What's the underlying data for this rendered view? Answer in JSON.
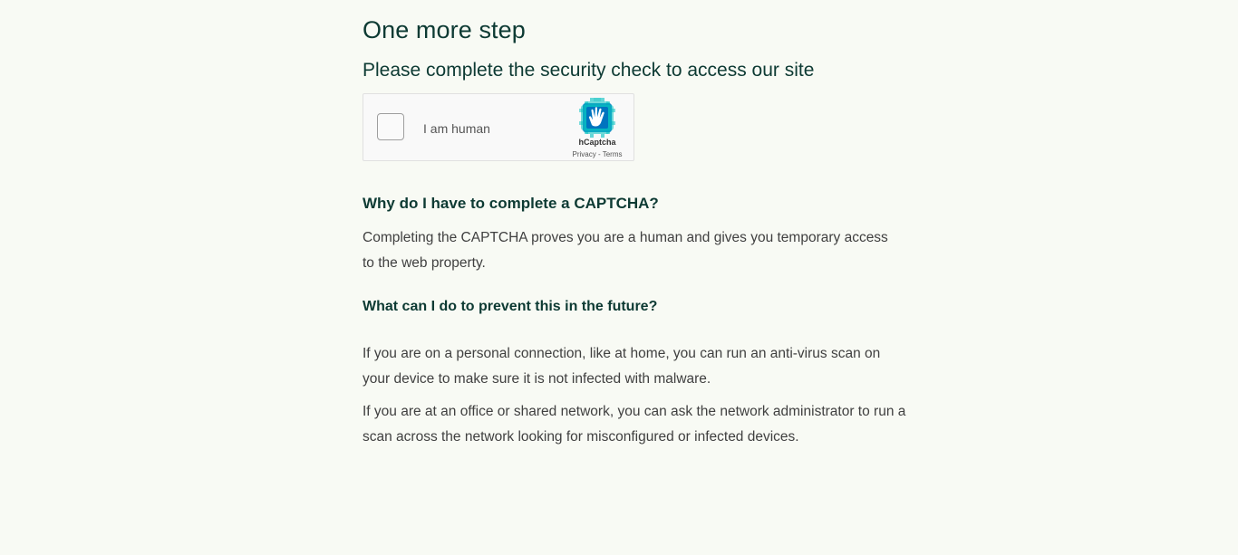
{
  "page": {
    "title": "One more step",
    "subtitle": "Please complete the security check to access our site"
  },
  "captcha": {
    "label": "I am human",
    "brand": "hCaptcha",
    "privacy_link": "Privacy",
    "separator": " - ",
    "terms_link": "Terms",
    "checked": false,
    "logo_icon": "hcaptcha-hand-icon",
    "colors": {
      "logo_dark": "#0074bf",
      "logo_mid": "#0082bf",
      "logo_light": "#00bfbf"
    }
  },
  "faq": {
    "q1": "Why do I have to complete a CAPTCHA?",
    "a1": "Completing the CAPTCHA proves you are a human and gives you temporary access to the web property.",
    "q2": "What can I do to prevent this in the future?",
    "a2": "If you are on a personal connection, like at home, you can run an anti-virus scan on your device to make sure it is not infected with malware.",
    "a3": "If you are at an office or shared network, you can ask the network administrator to run a scan across the network looking for misconfigured or infected devices."
  },
  "colors": {
    "background": "#f8faf4",
    "heading": "#0d3a33",
    "body_text": "#404040"
  }
}
